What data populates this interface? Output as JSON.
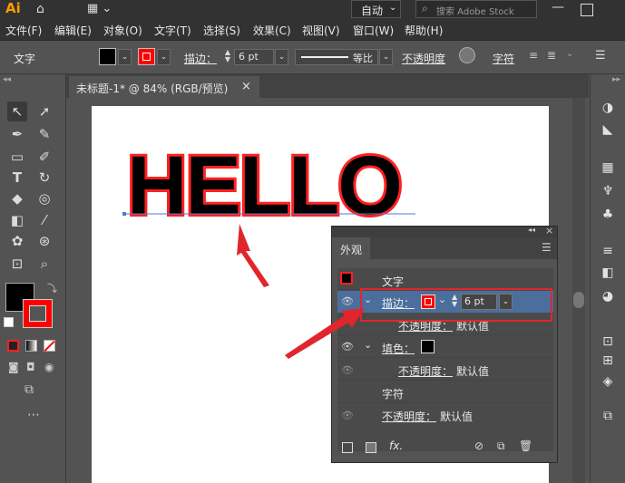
{
  "app": {
    "logo": "Ai",
    "workspace": "自动",
    "search_placeholder": "搜索 Adobe Stock"
  },
  "menu": [
    "文件(F)",
    "编辑(E)",
    "对象(O)",
    "文字(T)",
    "选择(S)",
    "效果(C)",
    "视图(V)",
    "窗口(W)",
    "帮助(H)"
  ],
  "control": {
    "selection": "文字",
    "stroke_label": "描边：",
    "stroke_weight": "6 pt",
    "profile": "等比",
    "opacity": "不透明度",
    "char": "字符"
  },
  "document": {
    "tab_title": "未标题-1* @ 84% (RGB/预览)",
    "close": "×"
  },
  "artwork": {
    "text": "HELLO",
    "fill": "#000000",
    "stroke": "#ff2020"
  },
  "panel": {
    "title": "外观",
    "rows": {
      "object": "文字",
      "stroke_label": "描边：",
      "stroke_weight": "6 pt",
      "stroke_opacity": "不透明度：",
      "default1": "默认值",
      "fill_label": "填色：",
      "fill_opacity": "不透明度：",
      "default2": "默认值",
      "characters": "字符",
      "opacity": "不透明度：",
      "default3": "默认值"
    },
    "fx": "fx."
  },
  "colors": {
    "highlight": "#e0262c",
    "selection_row": "#4b6e9c"
  }
}
